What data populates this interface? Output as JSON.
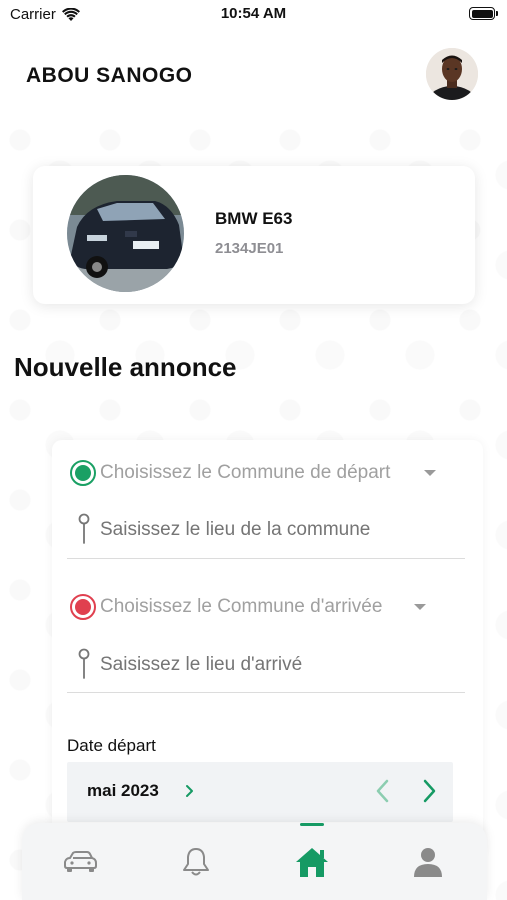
{
  "status_bar": {
    "carrier": "Carrier",
    "time": "10:54 AM"
  },
  "header": {
    "user_name": "ABOU SANOGO"
  },
  "vehicle": {
    "model": "BMW E63",
    "plate": "2134JE01"
  },
  "section_title": "Nouvelle annonce",
  "form": {
    "departure_commune_placeholder": "Choisissez le Commune de départ",
    "departure_place_placeholder": "Saisissez le lieu de la commune",
    "arrival_commune_placeholder": "Choisissez le Commune d'arrivée",
    "arrival_place_placeholder": "Saisissez le lieu d'arrivé",
    "date_label": "Date départ",
    "calendar_month": "mai 2023"
  },
  "colors": {
    "accent": "#169a64",
    "departure_dot": "#1aa064",
    "arrival_dot": "#e0404f"
  },
  "tab_bar": {
    "tabs": [
      {
        "icon": "car-icon",
        "active": false
      },
      {
        "icon": "bell-icon",
        "active": false
      },
      {
        "icon": "home-icon",
        "active": true
      },
      {
        "icon": "person-icon",
        "active": false
      }
    ]
  }
}
